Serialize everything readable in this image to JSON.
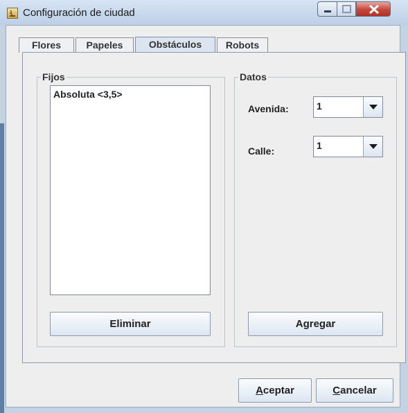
{
  "window": {
    "title": "Configuración de ciudad"
  },
  "tabs": [
    {
      "label": "Flores",
      "selected": false
    },
    {
      "label": "Papeles",
      "selected": false
    },
    {
      "label": "Obstáculos",
      "selected": true
    },
    {
      "label": "Robots",
      "selected": false
    }
  ],
  "fijos": {
    "title": "Fijos",
    "items": [
      "Absoluta <3,5>"
    ],
    "delete_label": "Eliminar"
  },
  "datos": {
    "title": "Datos",
    "avenida_label": "Avenida:",
    "avenida_value": "1",
    "calle_label": "Calle:",
    "calle_value": "1",
    "add_label": "Agregar"
  },
  "footer": {
    "accept_label": "ceptar",
    "accept_mnemonic": "A",
    "cancel_label": "ancelar",
    "cancel_mnemonic": "C"
  },
  "colors": {
    "close_button": "#c6463a",
    "tab_selected": "#dbe4ef"
  },
  "icons": [
    "java-app-icon",
    "minimize-icon",
    "maximize-icon",
    "close-icon",
    "chevron-down-icon"
  ]
}
